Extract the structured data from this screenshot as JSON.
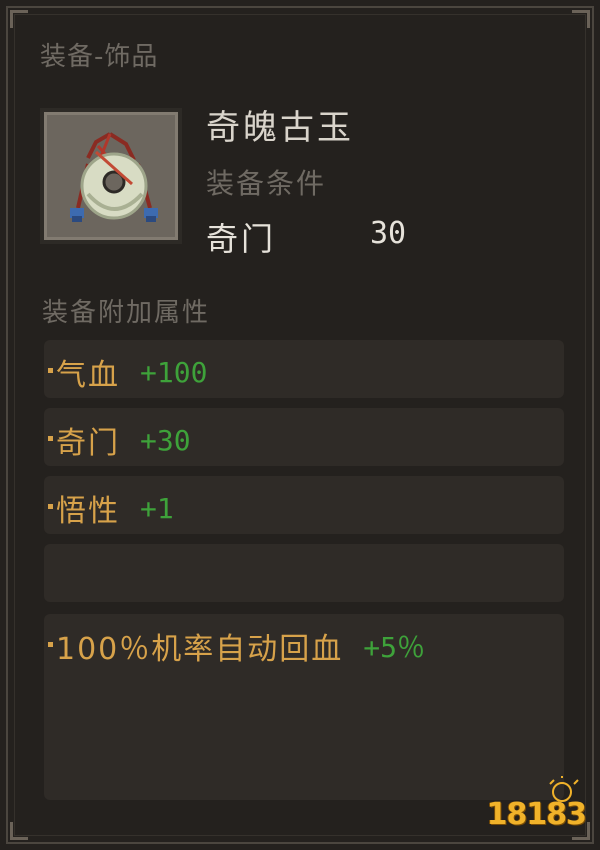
{
  "panel": {
    "category": "装备-饰品"
  },
  "item": {
    "name": "奇魄古玉",
    "icon": "jade-pendant-icon",
    "requirement_label": "装备条件",
    "requirement_stat": "奇门",
    "requirement_value": "30"
  },
  "attributes": {
    "header": "装备附加属性",
    "rows": [
      {
        "name": "气血",
        "value": "+100"
      },
      {
        "name": "奇门",
        "value": "+30"
      },
      {
        "name": "悟性",
        "value": "+1"
      },
      {
        "name": "",
        "value": ""
      },
      {
        "name": "100％机率自动回血",
        "value": "+5％"
      }
    ]
  },
  "watermark": {
    "text": "18183"
  },
  "colors": {
    "attr_name": "#d7a24a",
    "attr_value": "#3ea23a",
    "muted": "#6f6a63",
    "background": "#24211e"
  }
}
